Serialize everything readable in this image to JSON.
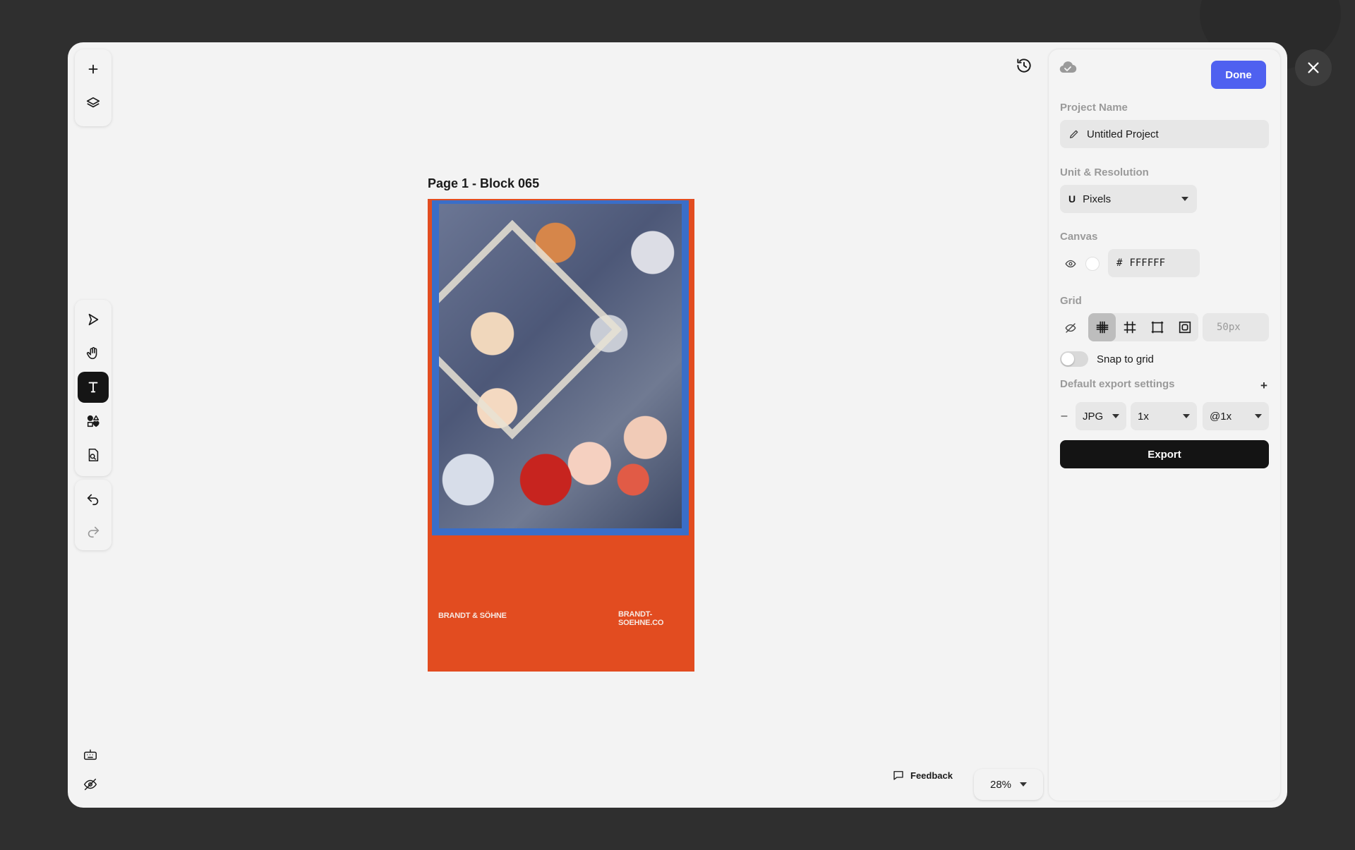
{
  "canvas": {
    "page_title": "Page 1 - Block 065",
    "artboard": {
      "brand_left": "BRANDT & SÖHNE",
      "brand_right": "BRANDT-SOEHNE.CO"
    },
    "feedback_label": "Feedback",
    "zoom_value": "28%"
  },
  "left_toolbar": {
    "top_icons": [
      "plus-icon",
      "layers-icon"
    ],
    "tools": [
      "select-arrow-icon",
      "hand-icon",
      "text-icon",
      "shapes-icon",
      "import-file-icon"
    ],
    "history_icons": [
      "undo-icon",
      "redo-icon"
    ],
    "active_tool": "text-icon"
  },
  "panel": {
    "done_label": "Done",
    "project_name_label": "Project Name",
    "project_name_value": "Untitled Project",
    "unit_label": "Unit & Resolution",
    "unit_prefix": "U",
    "unit_value": "Pixels",
    "canvas_label": "Canvas",
    "canvas_hash": "#",
    "canvas_color": "FFFFFF",
    "grid_label": "Grid",
    "grid_size": "50px",
    "snap_label": "Snap to grid",
    "export_settings_label": "Default export settings",
    "export_plus": "+",
    "export_minus": "–",
    "format": "JPG",
    "scale": "1x",
    "suffix": "@1x",
    "export_label": "Export"
  },
  "colors": {
    "accent": "#4F61F0",
    "artboard": "#E24C20",
    "photo_border": "#3A6EC8"
  }
}
